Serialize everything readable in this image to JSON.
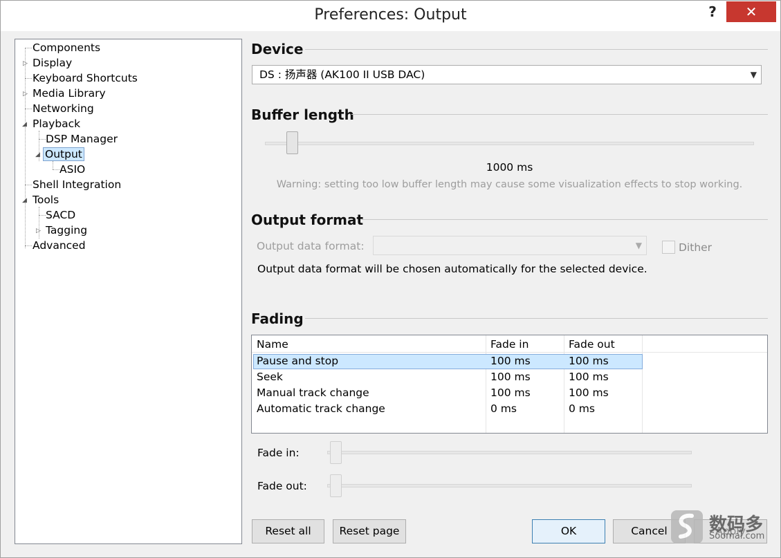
{
  "window": {
    "title": "Preferences: Output",
    "help_label": "?",
    "close_label": "✕"
  },
  "tree": {
    "items": [
      {
        "label": "Components"
      },
      {
        "label": "Display"
      },
      {
        "label": "Keyboard Shortcuts"
      },
      {
        "label": "Media Library"
      },
      {
        "label": "Networking"
      },
      {
        "label": "Playback"
      },
      {
        "label": "DSP Manager"
      },
      {
        "label": "Output",
        "selected": true
      },
      {
        "label": "ASIO"
      },
      {
        "label": "Shell Integration"
      },
      {
        "label": "Tools"
      },
      {
        "label": "SACD"
      },
      {
        "label": "Tagging"
      },
      {
        "label": "Advanced"
      }
    ]
  },
  "device": {
    "section_title": "Device",
    "selected_device": "DS : 扬声器 (AK100 II USB DAC)"
  },
  "buffer": {
    "section_title": "Buffer length",
    "value_label": "1000 ms",
    "level_fraction": 0.04,
    "warning": "Warning: setting too low buffer length may cause some visualization effects to stop working."
  },
  "output_format": {
    "section_title": "Output format",
    "data_format_label": "Output data format:",
    "data_format_value": "",
    "dither_label": "Dither",
    "dither_checked": false,
    "info": "Output data format will be chosen automatically for the selected device."
  },
  "fading": {
    "section_title": "Fading",
    "columns": [
      "Name",
      "Fade in",
      "Fade out"
    ],
    "rows": [
      {
        "name": "Pause and stop",
        "fade_in": "100 ms",
        "fade_out": "100 ms",
        "selected": true
      },
      {
        "name": "Seek",
        "fade_in": "100 ms",
        "fade_out": "100 ms"
      },
      {
        "name": "Manual track change",
        "fade_in": "100 ms",
        "fade_out": "100 ms"
      },
      {
        "name": "Automatic track change",
        "fade_in": "0 ms",
        "fade_out": "0 ms"
      }
    ],
    "fade_in_label": "Fade in:",
    "fade_out_label": "Fade out:",
    "fade_in_level": 0.0,
    "fade_out_level": 0.0
  },
  "buttons": {
    "reset_all": "Reset all",
    "reset_page": "Reset page",
    "ok": "OK",
    "cancel": "Cancel",
    "apply": "Apply"
  },
  "watermark": {
    "line1": "数码多",
    "line2": "Soomal.com"
  },
  "colors": {
    "selection": "#cce8ff",
    "close_button": "#c7372f"
  }
}
